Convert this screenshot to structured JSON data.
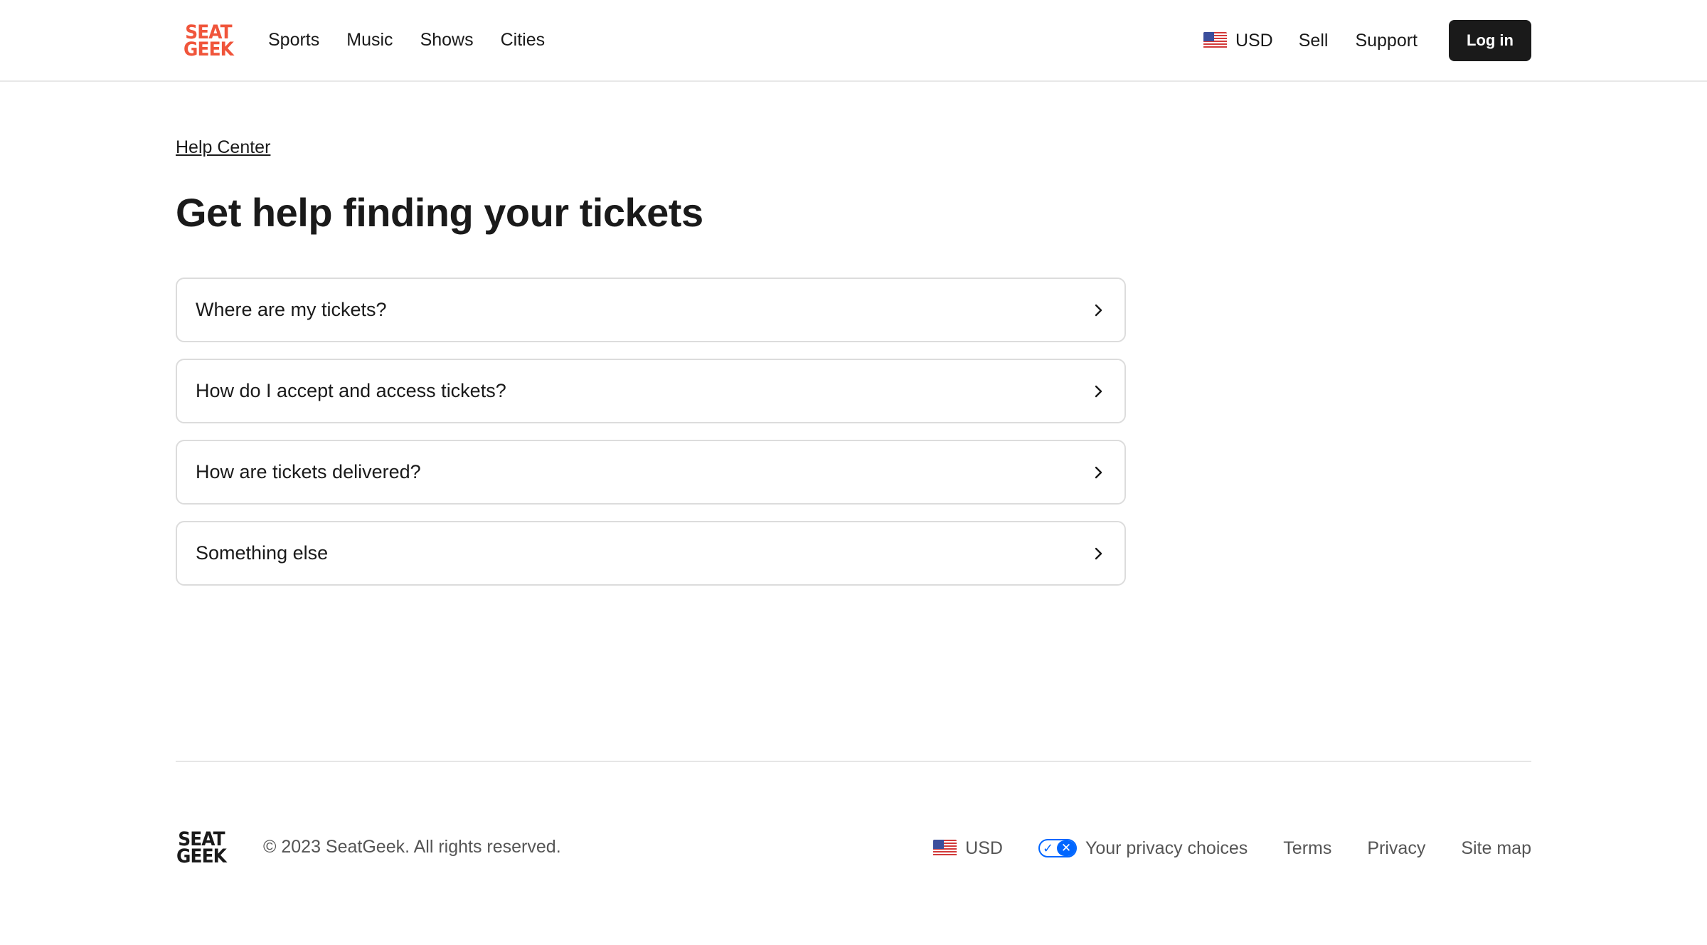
{
  "header": {
    "logo_line1": "SEAT",
    "logo_line2": "GEEK",
    "nav": [
      "Sports",
      "Music",
      "Shows",
      "Cities"
    ],
    "currency": "USD",
    "sell": "Sell",
    "support": "Support",
    "login": "Log in"
  },
  "breadcrumb": "Help Center",
  "title": "Get help finding your tickets",
  "options": [
    "Where are my tickets?",
    "How do I accept and access tickets?",
    "How are tickets delivered?",
    "Something else"
  ],
  "footer": {
    "logo_line1": "SEAT",
    "logo_line2": "GEEK",
    "copyright": "© 2023 SeatGeek. All rights reserved.",
    "currency": "USD",
    "privacy_choices": "Your privacy choices",
    "terms": "Terms",
    "privacy": "Privacy",
    "sitemap": "Site map"
  },
  "colors": {
    "brand": "#f0553b",
    "button_bg": "#1a1a1a",
    "privacy_blue": "#0066ff"
  },
  "icons": {
    "option_arrow": "chevron-right-icon",
    "currency_flag": "us-flag-icon",
    "privacy": "privacy-toggle-icon"
  }
}
